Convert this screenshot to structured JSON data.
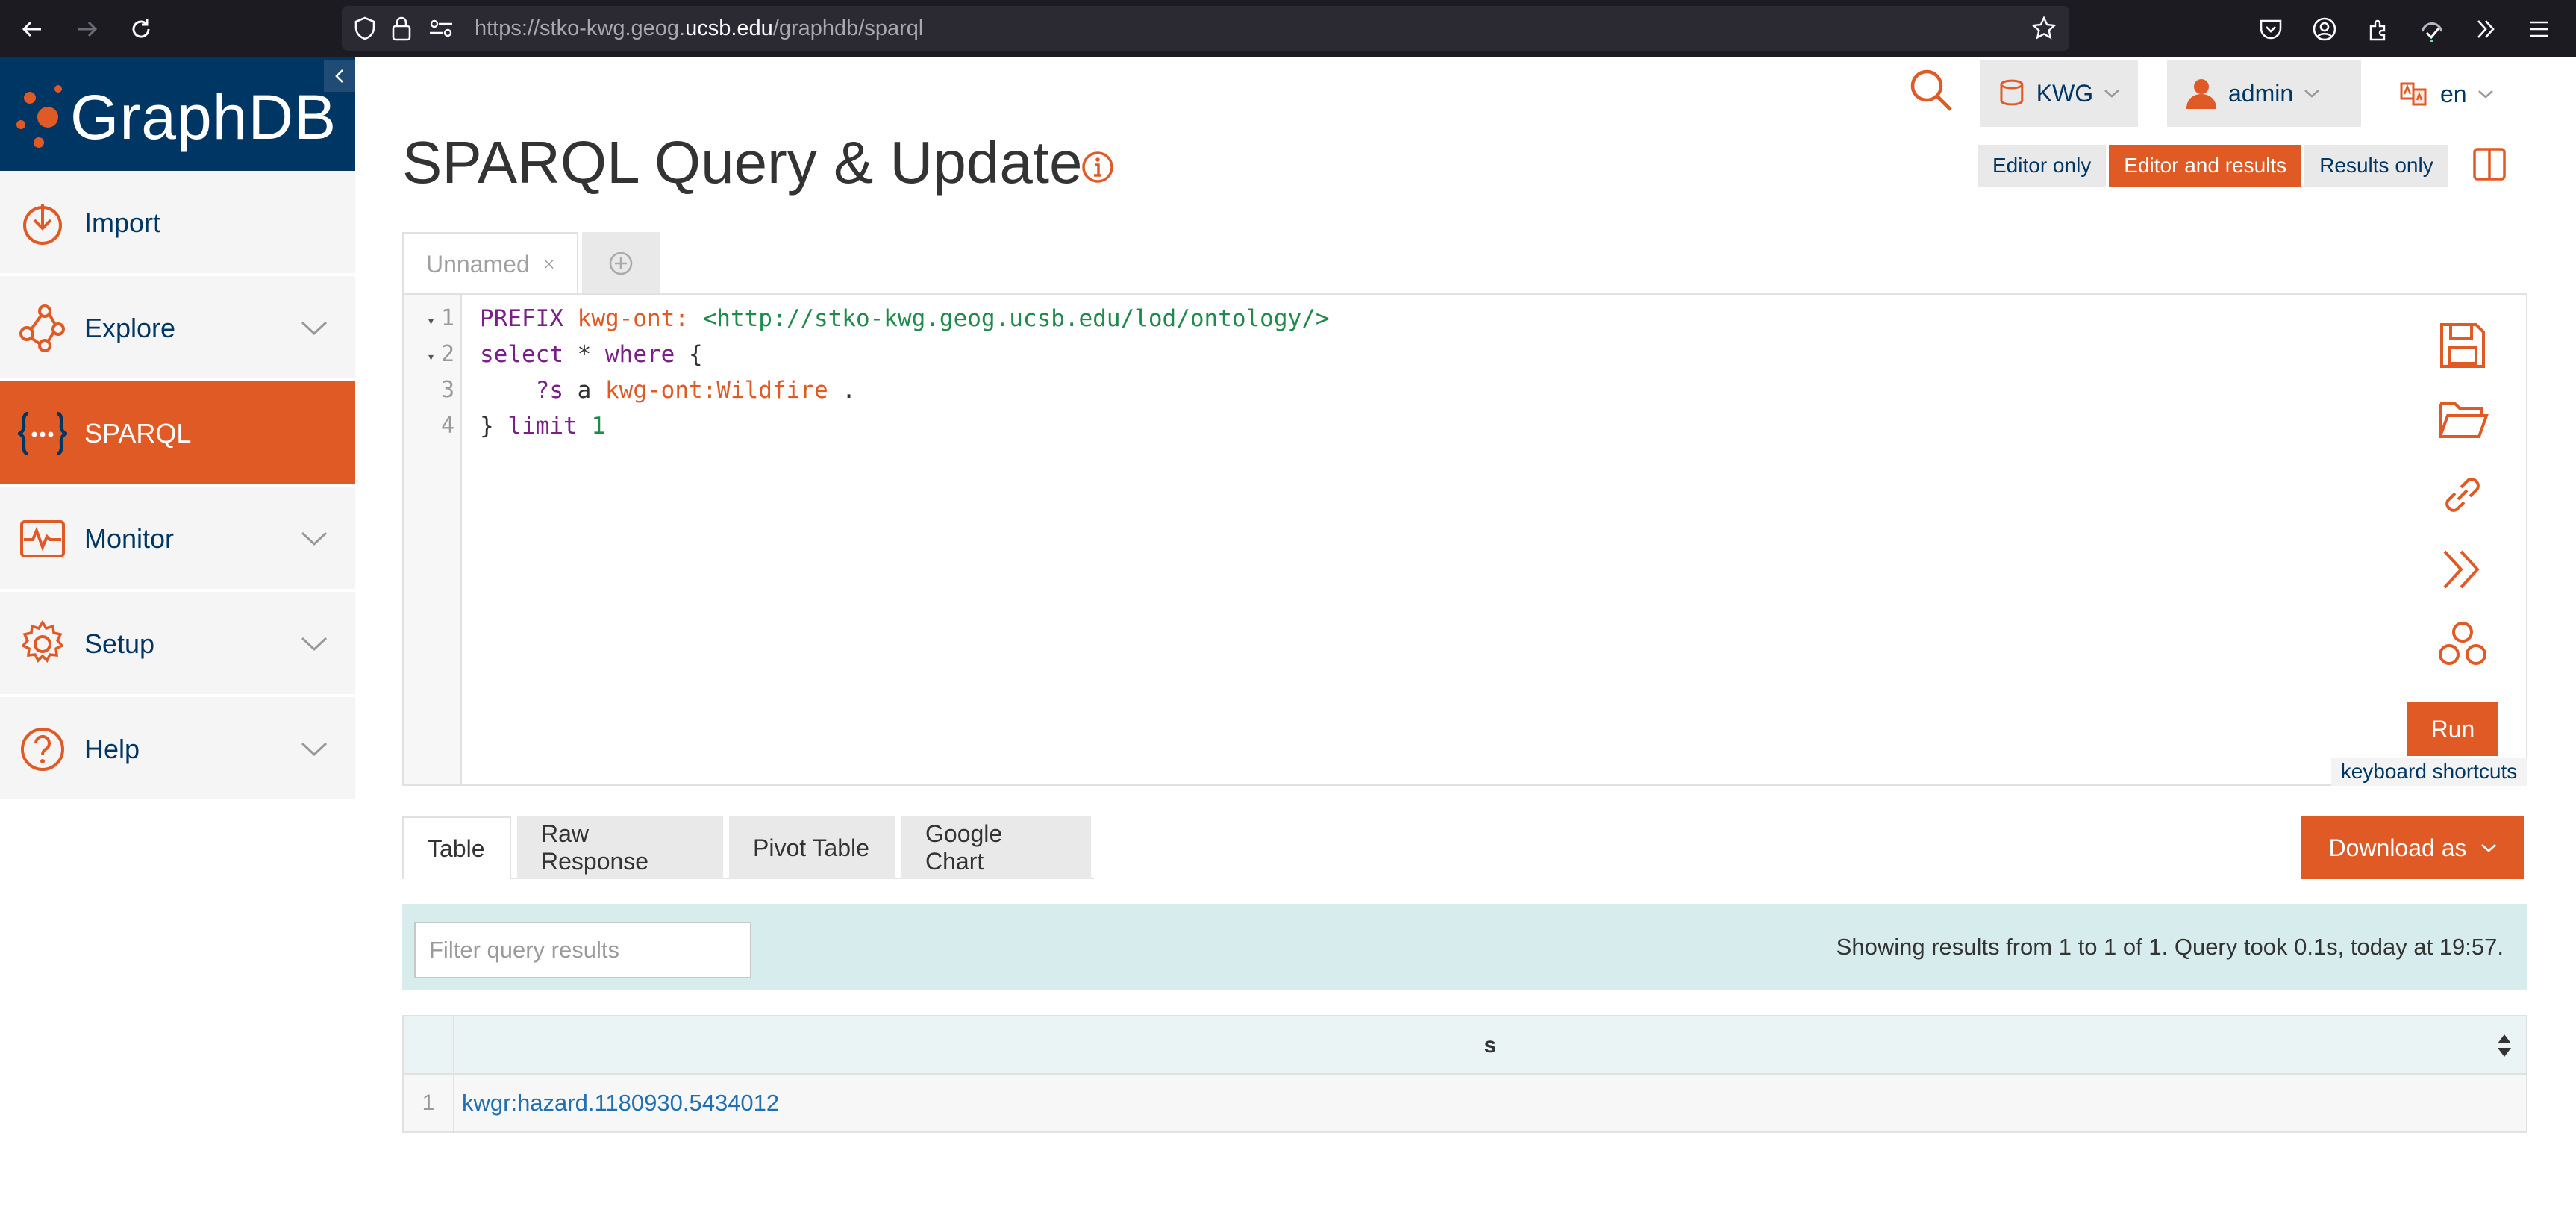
{
  "browser": {
    "url_prefix": "https://stko-kwg.geog.",
    "url_host": "ucsb.edu",
    "url_path": "/graphdb/sparql"
  },
  "brand": {
    "name": "GraphDB"
  },
  "sidebar": {
    "items": [
      {
        "label": "Import",
        "icon": "import-icon"
      },
      {
        "label": "Explore",
        "icon": "explore-icon"
      },
      {
        "label": "SPARQL",
        "icon": "sparql-icon",
        "active": true
      },
      {
        "label": "Monitor",
        "icon": "monitor-icon"
      },
      {
        "label": "Setup",
        "icon": "setup-icon"
      },
      {
        "label": "Help",
        "icon": "help-icon"
      }
    ]
  },
  "header": {
    "repository": "KWG",
    "user": "admin",
    "language": "en"
  },
  "page": {
    "title": "SPARQL Query & Update"
  },
  "view_modes": {
    "editor_only": "Editor only",
    "editor_and_results": "Editor and results",
    "results_only": "Results only"
  },
  "query_tabs": [
    {
      "label": "Unnamed"
    }
  ],
  "editor": {
    "line_numbers": [
      "1",
      "2",
      "3",
      "4"
    ],
    "run_label": "Run",
    "keyboard_shortcuts_label": "keyboard shortcuts"
  },
  "query": {
    "prefix_kw": "PREFIX",
    "prefix_name": "kwg-ont:",
    "prefix_iri": "<http://stko-kwg.geog.ucsb.edu/lod/ontology/>",
    "select_kw": "select",
    "star": "*",
    "where_kw": "where",
    "open_brace": "{",
    "var_s": "?s",
    "a_kw": "a",
    "class": "kwg-ont:Wildfire",
    "dot": ".",
    "close_brace": "}",
    "limit_kw": "limit",
    "limit_value": "1"
  },
  "result_tabs": {
    "table": "Table",
    "raw": "Raw Response",
    "pivot": "Pivot Table",
    "google": "Google Chart"
  },
  "download_label": "Download as",
  "results": {
    "filter_placeholder": "Filter query results",
    "info": "Showing results from 1 to 1 of 1. Query took 0.1s, today at 19:57.",
    "column": "s",
    "rows": [
      {
        "index": "1",
        "s": "kwgr:hazard.1180930.5434012"
      }
    ]
  },
  "colors": {
    "accent": "#e05a26",
    "brand_blue": "#003663"
  }
}
